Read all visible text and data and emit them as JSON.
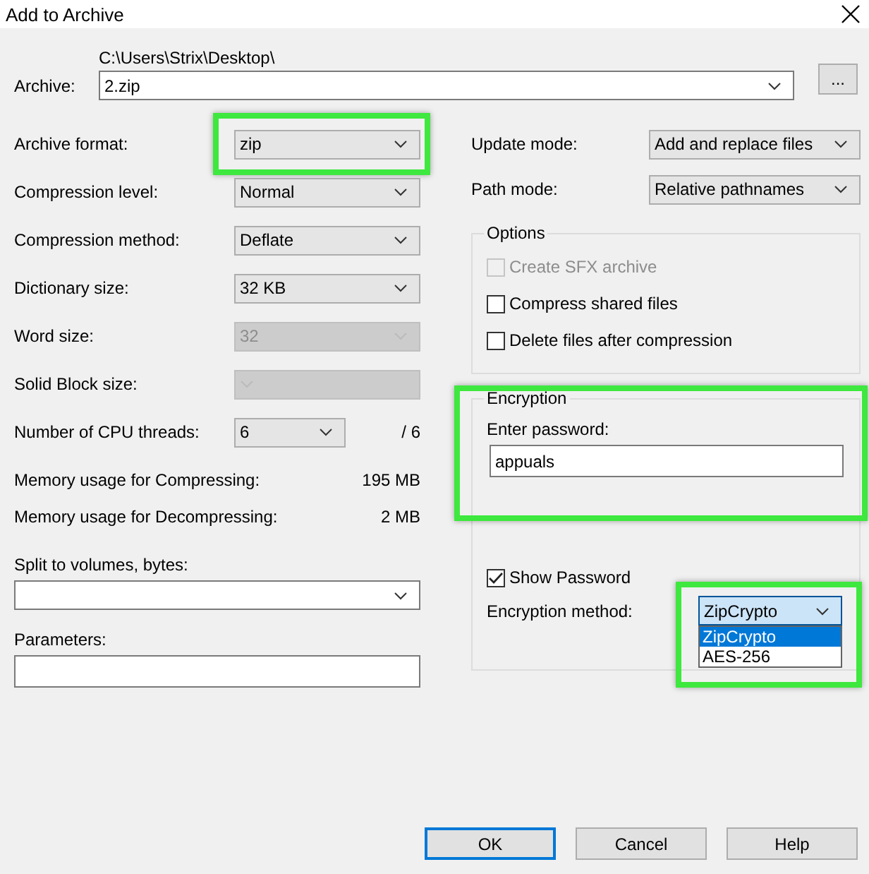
{
  "window": {
    "title": "Add to Archive"
  },
  "archive": {
    "label": "Archive:",
    "path": "C:\\Users\\Strix\\Desktop\\",
    "value": "2.zip",
    "browse": "..."
  },
  "left_rows": [
    {
      "label": "Archive format:",
      "value": "zip",
      "disabled": false,
      "highlighted": true
    },
    {
      "label": "Compression level:",
      "value": "Normal",
      "disabled": false,
      "highlighted": false
    },
    {
      "label": "Compression method:",
      "value": "Deflate",
      "disabled": false,
      "highlighted": false
    },
    {
      "label": "Dictionary size:",
      "value": "32 KB",
      "disabled": false,
      "highlighted": false
    },
    {
      "label": "Word size:",
      "value": "32",
      "disabled": true,
      "highlighted": false
    },
    {
      "label": "Solid Block size:",
      "disabled": true,
      "highlighted": false
    },
    {
      "label": "Number of CPU threads:",
      "value": "6",
      "suffix": "/ 6",
      "disabled": false,
      "highlighted": false
    }
  ],
  "memory": [
    {
      "label": "Memory usage for Compressing:",
      "value": "195 MB"
    },
    {
      "label": "Memory usage for Decompressing:",
      "value": "2 MB"
    }
  ],
  "split": {
    "label": "Split to volumes, bytes:"
  },
  "parameters": {
    "label": "Parameters:"
  },
  "right_rows": [
    {
      "label": "Update mode:",
      "value": "Add and replace files"
    },
    {
      "label": "Path mode:",
      "value": "Relative pathnames"
    }
  ],
  "options": {
    "title": "Options",
    "items": [
      {
        "label": "Create SFX archive",
        "checked": false,
        "disabled": true
      },
      {
        "label": "Compress shared files",
        "checked": false,
        "disabled": false
      },
      {
        "label": "Delete files after compression",
        "checked": false,
        "disabled": false
      }
    ]
  },
  "encryption": {
    "title": "Encryption",
    "highlighted": true,
    "password_label": "Enter password:",
    "password": "appuals",
    "show_password": {
      "label": "Show Password",
      "checked": true
    },
    "method_label": "Encryption method:",
    "method": {
      "value": "ZipCrypto",
      "open": true,
      "highlighted": true,
      "options": [
        {
          "label": "ZipCrypto",
          "selected": true
        },
        {
          "label": "AES-256",
          "selected": false
        }
      ]
    }
  },
  "buttons": [
    {
      "label": "OK",
      "default": true
    },
    {
      "label": "Cancel",
      "default": false
    },
    {
      "label": "Help",
      "default": false
    }
  ]
}
